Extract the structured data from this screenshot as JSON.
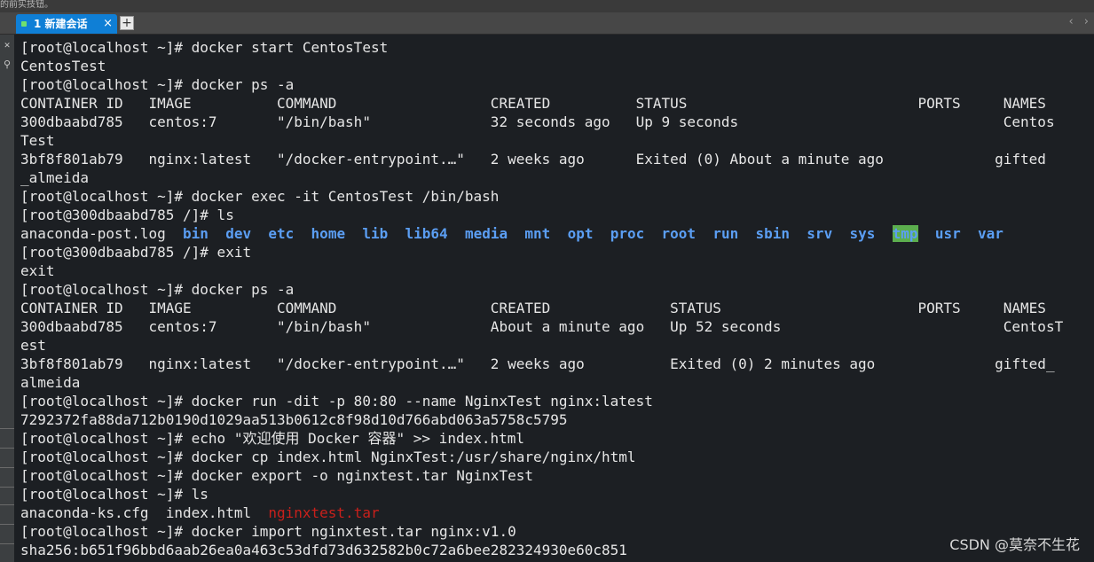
{
  "top_strip_text": "的前实技钮。",
  "tab": {
    "label": "1 新建会话",
    "close": "×"
  },
  "add_tab_label": "+",
  "nav_arrows": {
    "left": "‹",
    "right": "›"
  },
  "left_bar_icons": [
    "close-icon",
    "search-icon"
  ],
  "colors": {
    "terminal_bg": "#1c1f23",
    "terminal_text": "#e6e6e6",
    "directory": "#5b9ef3",
    "highlight_bg": "#5cae4e",
    "archive": "#c8201b",
    "tab_active": "#0f7fd6"
  },
  "watermark": "CSDN @莫奈不生花",
  "terminal": {
    "lines": [
      [
        {
          "t": "[root@localhost ~]# docker start CentosTest"
        }
      ],
      [
        {
          "t": "CentosTest"
        }
      ],
      [
        {
          "t": "[root@localhost ~]# docker ps -a"
        }
      ],
      [
        {
          "t": "CONTAINER ID   IMAGE          COMMAND                  CREATED          STATUS                           PORTS     NAMES"
        }
      ],
      [
        {
          "t": "300dbaabd785   centos:7       \"/bin/bash\"              32 seconds ago   Up 9 seconds                               Centos"
        }
      ],
      [
        {
          "t": "Test"
        }
      ],
      [
        {
          "t": "3bf8f801ab79   nginx:latest   \"/docker-entrypoint.…\"   2 weeks ago      Exited (0) About a minute ago             gifted"
        }
      ],
      [
        {
          "t": "_almeida"
        }
      ],
      [
        {
          "t": "[root@localhost ~]# docker exec -it CentosTest /bin/bash"
        }
      ],
      [
        {
          "t": "[root@300dbaabd785 /]# ls"
        }
      ],
      [
        {
          "t": "anaconda-post.log  "
        },
        {
          "t": "bin",
          "s": "dir"
        },
        {
          "t": "  "
        },
        {
          "t": "dev",
          "s": "dir"
        },
        {
          "t": "  "
        },
        {
          "t": "etc",
          "s": "dir"
        },
        {
          "t": "  "
        },
        {
          "t": "home",
          "s": "dir"
        },
        {
          "t": "  "
        },
        {
          "t": "lib",
          "s": "dir"
        },
        {
          "t": "  "
        },
        {
          "t": "lib64",
          "s": "dir"
        },
        {
          "t": "  "
        },
        {
          "t": "media",
          "s": "dir"
        },
        {
          "t": "  "
        },
        {
          "t": "mnt",
          "s": "dir"
        },
        {
          "t": "  "
        },
        {
          "t": "opt",
          "s": "dir"
        },
        {
          "t": "  "
        },
        {
          "t": "proc",
          "s": "dir"
        },
        {
          "t": "  "
        },
        {
          "t": "root",
          "s": "dir"
        },
        {
          "t": "  "
        },
        {
          "t": "run",
          "s": "dir"
        },
        {
          "t": "  "
        },
        {
          "t": "sbin",
          "s": "dir"
        },
        {
          "t": "  "
        },
        {
          "t": "srv",
          "s": "dir"
        },
        {
          "t": "  "
        },
        {
          "t": "sys",
          "s": "dir"
        },
        {
          "t": "  "
        },
        {
          "t": "tmp",
          "s": "hl"
        },
        {
          "t": "  "
        },
        {
          "t": "usr",
          "s": "dir"
        },
        {
          "t": "  "
        },
        {
          "t": "var",
          "s": "dir"
        }
      ],
      [
        {
          "t": "[root@300dbaabd785 /]# exit"
        }
      ],
      [
        {
          "t": "exit"
        }
      ],
      [
        {
          "t": "[root@localhost ~]# docker ps -a"
        }
      ],
      [
        {
          "t": "CONTAINER ID   IMAGE          COMMAND                  CREATED              STATUS                       PORTS     NAMES"
        }
      ],
      [
        {
          "t": "300dbaabd785   centos:7       \"/bin/bash\"              About a minute ago   Up 52 seconds                          CentosT"
        }
      ],
      [
        {
          "t": "est"
        }
      ],
      [
        {
          "t": "3bf8f801ab79   nginx:latest   \"/docker-entrypoint.…\"   2 weeks ago          Exited (0) 2 minutes ago              gifted_"
        }
      ],
      [
        {
          "t": "almeida"
        }
      ],
      [
        {
          "t": "[root@localhost ~]# docker run -dit -p 80:80 --name NginxTest nginx:latest"
        }
      ],
      [
        {
          "t": "7292372fa88da712b0190d1029aa513b0612c8f98d10d766abd063a5758c5795"
        }
      ],
      [
        {
          "t": "[root@localhost ~]# echo \"欢迎使用 Docker 容器\" >> index.html"
        }
      ],
      [
        {
          "t": "[root@localhost ~]# docker cp index.html NginxTest:/usr/share/nginx/html"
        }
      ],
      [
        {
          "t": "[root@localhost ~]# docker export -o nginxtest.tar NginxTest"
        }
      ],
      [
        {
          "t": "[root@localhost ~]# ls"
        }
      ],
      [
        {
          "t": "anaconda-ks.cfg  index.html  "
        },
        {
          "t": "nginxtest.tar",
          "s": "red"
        }
      ],
      [
        {
          "t": "[root@localhost ~]# docker import nginxtest.tar nginx:v1.0"
        }
      ],
      [
        {
          "t": "sha256:b651f96bbd6aab26ea0a463c53dfd73d632582b0c72a6bee282324930e60c851"
        }
      ]
    ]
  }
}
